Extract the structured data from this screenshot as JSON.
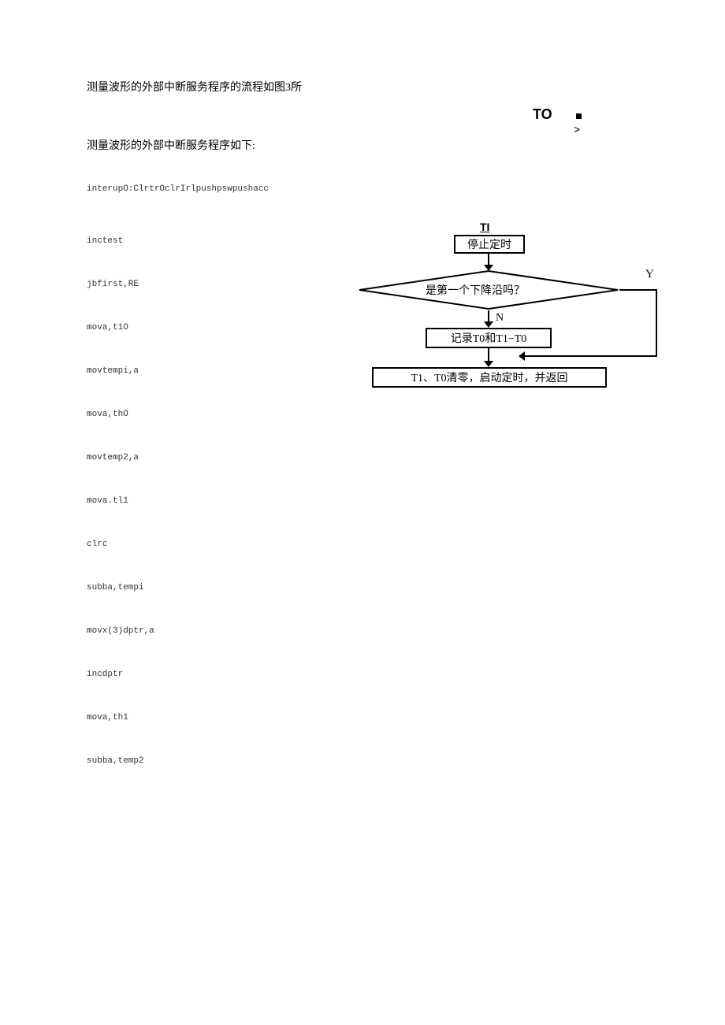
{
  "paragraph1": "测量波形的外部中断服务程序的流程如图3所",
  "paragraph2": "测量波形的外部中断服务程序如下:",
  "topRight": {
    "to": "TO",
    "gt": ">"
  },
  "code": {
    "line0": "interupO:ClrtrOclrIrlpushpswpushacc",
    "line1": "inctest",
    "line2": "jbfirst,RE",
    "line3": "mova,t1O",
    "line4": "movtempi,a",
    "line5": "mova,thO",
    "line6": "movtemp2,a",
    "line7": "mova.tl1",
    "line8": "clrc",
    "line9": "subba,tempi",
    "line10": "movx(3)dptr,a",
    "line11": "incdptr",
    "line12": "mova,th1",
    "line13": "subba,temp2"
  },
  "flowchart": {
    "tl": "TI",
    "box1": "停止定时",
    "diamond": "是第一个下降沿吗？",
    "yLabel": "Y",
    "nLabel": "N",
    "box2": "记录T0和T1−T0",
    "box3": "T1、T0清零，启动定时，并返回"
  }
}
